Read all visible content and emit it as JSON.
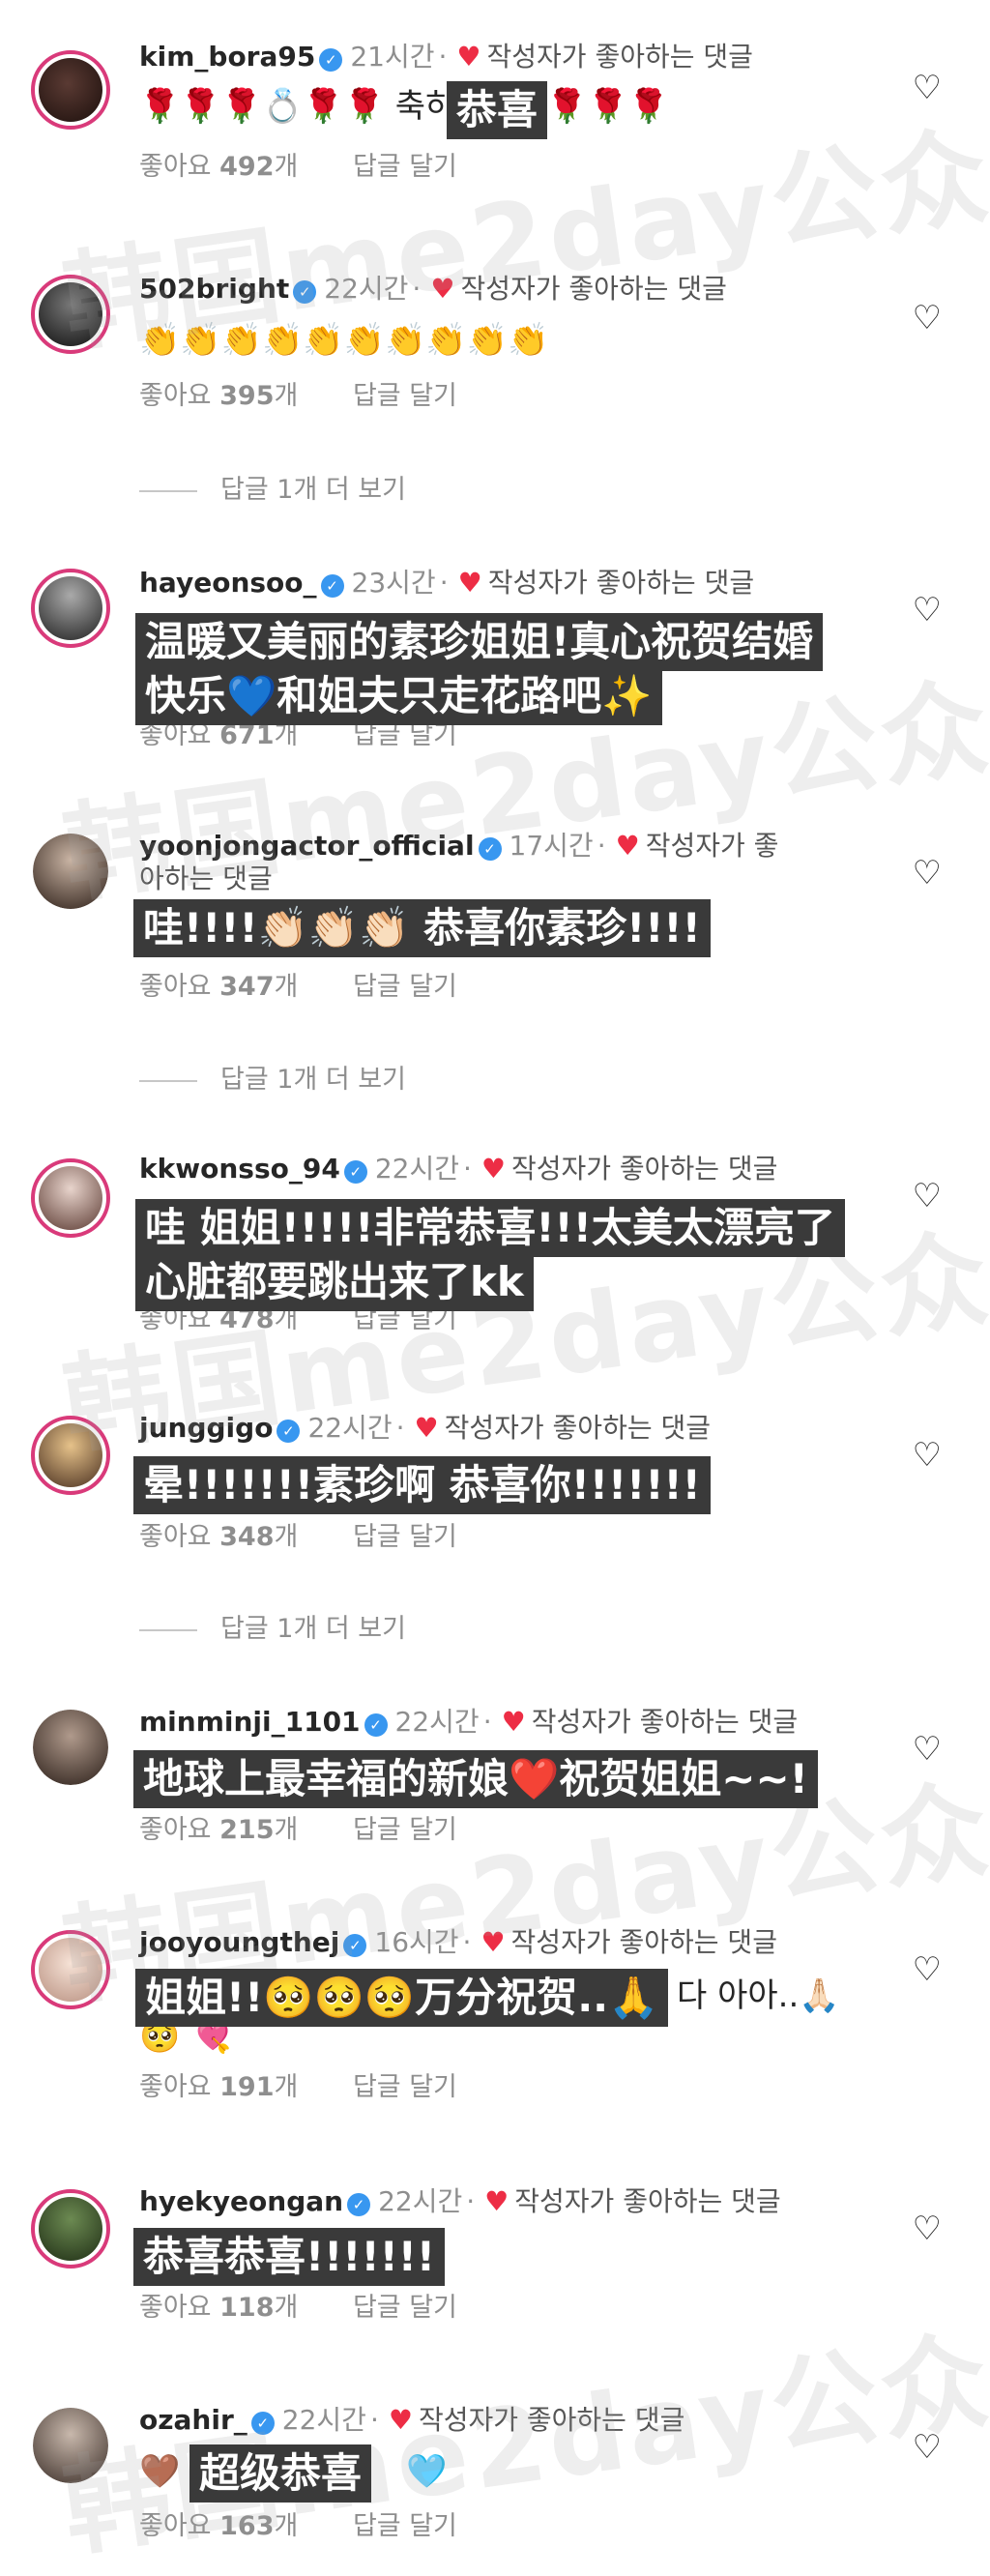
{
  "watermark_text": "韩国me2day公众号",
  "liked_label": "작성자가 좋아하는 댓글",
  "like_prefix": "좋아요",
  "like_suffix": "개",
  "reply_label": "답글 달기",
  "more_replies_label": "답글 1개 더 보기",
  "comments": [
    {
      "username": "kim_bora95",
      "time": "21시간",
      "body": "🌹🌹🌹💍🌹🌹  축하합니다🌹🌹🌹",
      "overlay": "恭喜",
      "likes": "492"
    },
    {
      "username": "502bright",
      "time": "22시간",
      "body": "👏👏👏👏👏👏👏👏👏👏",
      "likes": "395"
    },
    {
      "username": "hayeonsoo_",
      "time": "23시간",
      "overlay1": "温暖又美丽的素珍姐姐!真心祝贺结婚",
      "overlay2": "快乐💙和姐夫只走花路吧✨",
      "likes": "671"
    },
    {
      "username": "yoonjongactor_official",
      "time": "17시간",
      "liked_wrap": "아하는 댓글",
      "overlay": "哇!!!!👏🏻👏🏻👏🏻 恭喜你素珍!!!!",
      "likes": "347"
    },
    {
      "username": "kkwonsso_94",
      "time": "22시간",
      "overlay1": "哇 姐姐!!!!!非常恭喜!!!太美太漂亮了",
      "overlay2": "心脏都要跳出来了kk",
      "likes": "478"
    },
    {
      "username": "junggigo",
      "time": "22시간",
      "overlay": "晕!!!!!!!素珍啊 恭喜你!!!!!!!",
      "likes": "348"
    },
    {
      "username": "minminji_1101",
      "time": "22시간",
      "overlay": "地球上最幸福的新娘❤️祝贺姐姐~~!",
      "likes": "215"
    },
    {
      "username": "jooyoungthej",
      "time": "16시간",
      "overlay": "姐姐!!🥺🥺🥺万分祝贺..🙏",
      "body_tail": "다 아아..🙏🏻",
      "body2": "🥺 💘",
      "likes": "191"
    },
    {
      "username": "hyekyeongan",
      "time": "22시간",
      "overlay": "恭喜恭喜!!!!!!!",
      "likes": "118"
    },
    {
      "username": "ozahir_",
      "time": "22시간",
      "body_pre": "🤎",
      "overlay": "超级恭喜",
      "body_post": "🩵",
      "likes": "163"
    }
  ],
  "colors": {
    "accent_heart": "#ed2d45",
    "verified": "#3897f0",
    "overlay_bg": "#3a3a3a"
  }
}
